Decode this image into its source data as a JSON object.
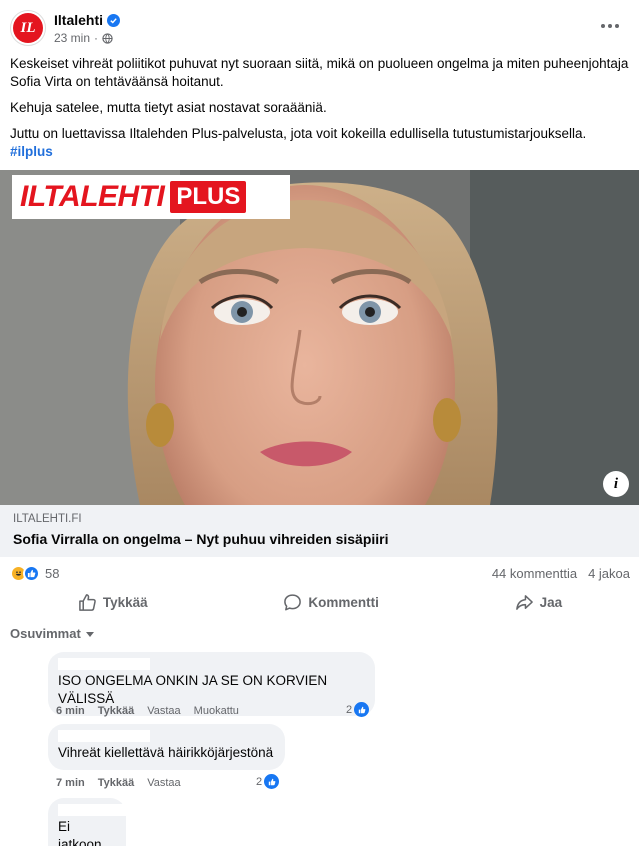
{
  "post": {
    "page_name": "Iltalehti",
    "avatar_text": "IL",
    "time": "23 min",
    "separator": "·",
    "paragraphs": [
      "Keskeiset vihreät poliitikot puhuvat nyt suoraan siitä, mikä on puolueen ongelma ja miten puheenjohtaja Sofia Virta on tehtäväänsä hoitanut.",
      "Kehuja satelee, mutta tietyt asiat nostavat soraääniä.",
      "Juttu on luettavissa Iltalehden Plus-palvelusta, jota voit kokeilla edullisella tutustumistarjouksella."
    ],
    "hashtag": "#ilplus"
  },
  "image": {
    "logo_text": "ILTALEHTI",
    "logo_plus": "PLUS",
    "info_icon_text": "i"
  },
  "link": {
    "domain": "ILTALEHTI.FI",
    "title": "Sofia Virralla on ongelma – Nyt puhuu vihreiden sisäpiiri"
  },
  "stats": {
    "reaction_count": "58",
    "comments": "44 kommenttia",
    "shares": "4 jakoa"
  },
  "actions": {
    "like": "Tykkää",
    "comment": "Kommentti",
    "share": "Jaa"
  },
  "sort": {
    "label": "Osuvimmat"
  },
  "comments": [
    {
      "text": "ISO ONGELMA ONKIN JA SE ON KORVIEN VÄLISSÄ",
      "time": "6 min",
      "like": "Tykkää",
      "reply": "Vastaa",
      "edited": "Muokattu",
      "likes": "2"
    },
    {
      "text": "Vihreät kiellettävä häirikköjärjestönä",
      "time": "7 min",
      "like": "Tykkää",
      "reply": "Vastaa",
      "likes": "2"
    },
    {
      "text": "Ei jatkoon"
    }
  ],
  "colors": {
    "brand_red": "#e4151f",
    "facebook_blue": "#1877f2",
    "secondary_text": "#65676b",
    "bubble_bg": "#f0f2f5",
    "hashtag": "#216fdb"
  }
}
